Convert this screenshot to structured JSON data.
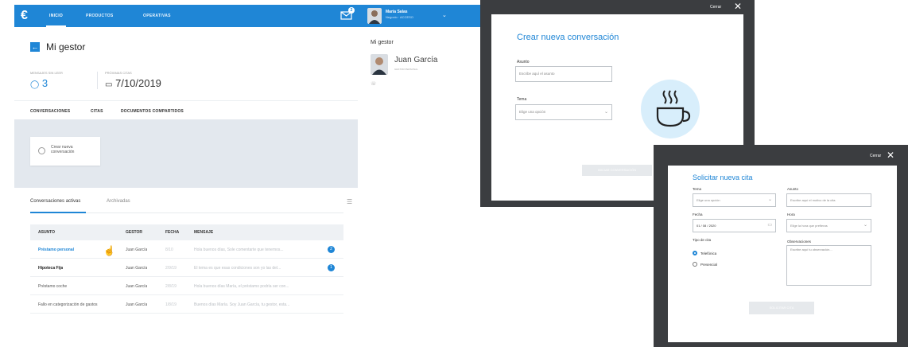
{
  "app": {
    "logo": "€",
    "nav": [
      "INICIO",
      "PRODUCTOS",
      "OPERATIVAS"
    ],
    "notification_count": "2",
    "user": {
      "name": "María Salas",
      "role": "Negocio · ACCESO"
    },
    "page_title": "Mi gestor",
    "stats": [
      {
        "label": "MENSAJES SIN LEER",
        "value": "3",
        "icon": "chat-icon"
      },
      {
        "label": "PRÓXIMAS CITAS",
        "value": "7/10/2019",
        "icon": "calendar-icon"
      }
    ],
    "tabs": [
      "CONVERSACIONES",
      "CITAS",
      "DOCUMENTOS COMPARTIDOS"
    ],
    "create_conversation_label": "Crear nueva conversación",
    "subtabs": [
      "Conversaciones activas",
      "Archivadas"
    ],
    "table": {
      "headers": [
        "ASUNTO",
        "GESTOR",
        "FECHA",
        "MENSAJE"
      ],
      "rows": [
        {
          "subject": "Préstamo personal",
          "manager": "Juan García",
          "date": "8/10",
          "message": "Hola buenos días, Sole comentarte que tenemos...",
          "unread": "2"
        },
        {
          "subject": "Hipoteca Fija",
          "manager": "Juan García",
          "date": "2/9/19",
          "message": "El tema es que esas condiciones son yo las del...",
          "unread": "1"
        },
        {
          "subject": "Préstamo coche",
          "manager": "Juan García",
          "date": "2/8/19",
          "message": "Hola buenos días María, el préstamo podría ser con...",
          "unread": ""
        },
        {
          "subject": "Fallo en categorización de gastos",
          "manager": "Juan García",
          "date": "1/8/19",
          "message": "Buenos días María. Soy Juan García, tu gestor, esta...",
          "unread": ""
        }
      ]
    },
    "side": {
      "title": "Mi gestor",
      "name": "Juan García",
      "role": "GESTOR PERSONAL",
      "phone_icon": "phone-icon"
    }
  },
  "modal_conversation": {
    "close_label": "Cerrar",
    "title": "Crear nueva conversación",
    "subject_label": "Asunto",
    "subject_placeholder": "Escribe aquí el asunto",
    "topic_label": "Tema",
    "topic_placeholder": "Elige una opción",
    "submit_label": "INICIAR CONVERSACIÓN",
    "illustration": "coffee-cup-icon"
  },
  "modal_appointment": {
    "close_label": "Cerrar",
    "title": "Solicitar nueva cita",
    "topic_label": "Tema",
    "topic_placeholder": "Elige una opción",
    "subject_label": "Asunto",
    "subject_placeholder": "Escribe aquí el motivo de la cita",
    "date_label": "Fecha",
    "date_value": "01 / 08 / 2020",
    "time_label": "Hora",
    "time_placeholder": "Elige la hora que prefieras",
    "type_label": "Tipo de cita",
    "type_options": [
      "Telefónica",
      "Presencial"
    ],
    "selected_type": "Telefónica",
    "notes_label": "Observaciones",
    "notes_placeholder": "Escribe aquí tu observación...",
    "submit_label": "SOLICITAR CITA"
  },
  "colors": {
    "accent": "#1f86d6",
    "frame": "#3b3d40",
    "grey_area": "#e3e8ee"
  }
}
